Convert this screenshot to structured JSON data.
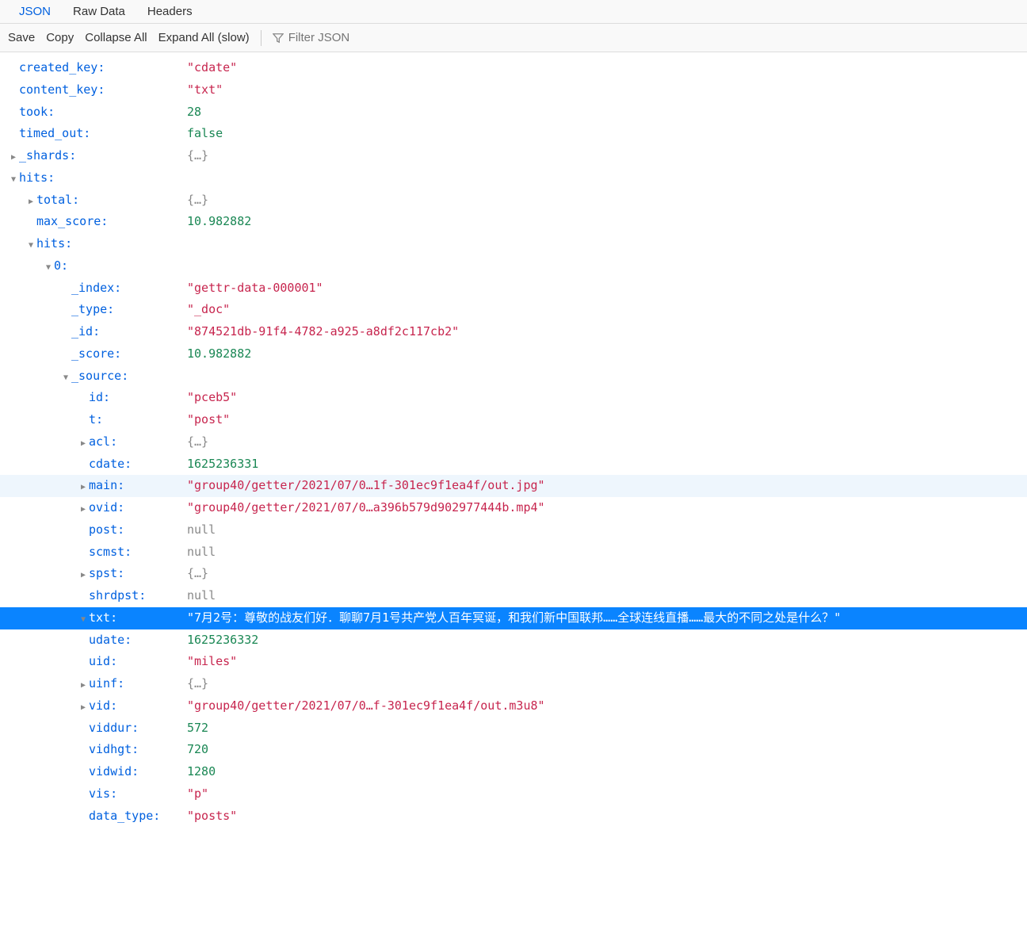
{
  "tabs": {
    "json": "JSON",
    "raw": "Raw Data",
    "headers": "Headers"
  },
  "toolbar": {
    "save": "Save",
    "copy": "Copy",
    "collapseAll": "Collapse All",
    "expandAll": "Expand All (slow)",
    "filterPlaceholder": "Filter JSON"
  },
  "rows": [
    {
      "indent": 1,
      "tg": "",
      "key": "created_key:",
      "vt": "string",
      "v": "\"cdate\""
    },
    {
      "indent": 1,
      "tg": "",
      "key": "content_key:",
      "vt": "string",
      "v": "\"txt\""
    },
    {
      "indent": 1,
      "tg": "",
      "key": "took:",
      "vt": "number",
      "v": "28"
    },
    {
      "indent": 1,
      "tg": "",
      "key": "timed_out:",
      "vt": "bool",
      "v": "false"
    },
    {
      "indent": 1,
      "tg": "r",
      "key": "_shards:",
      "vt": "obj",
      "v": "{…}"
    },
    {
      "indent": 1,
      "tg": "d",
      "key": "hits:",
      "vt": "",
      "v": ""
    },
    {
      "indent": 2,
      "tg": "r",
      "key": "total:",
      "vt": "obj",
      "v": "{…}"
    },
    {
      "indent": 2,
      "tg": "",
      "key": "max_score:",
      "vt": "number",
      "v": "10.982882"
    },
    {
      "indent": 2,
      "tg": "d",
      "key": "hits:",
      "vt": "",
      "v": ""
    },
    {
      "indent": 3,
      "tg": "d",
      "key": "0:",
      "vt": "",
      "v": ""
    },
    {
      "indent": 4,
      "tg": "",
      "key": "_index:",
      "vt": "string",
      "v": "\"gettr-data-000001\""
    },
    {
      "indent": 4,
      "tg": "",
      "key": "_type:",
      "vt": "string",
      "v": "\"_doc\""
    },
    {
      "indent": 4,
      "tg": "",
      "key": "_id:",
      "vt": "string",
      "v": "\"874521db-91f4-4782-a925-a8df2c117cb2\""
    },
    {
      "indent": 4,
      "tg": "",
      "key": "_score:",
      "vt": "number",
      "v": "10.982882"
    },
    {
      "indent": 4,
      "tg": "d",
      "key": "_source:",
      "vt": "",
      "v": ""
    },
    {
      "indent": 5,
      "tg": "",
      "key": "id:",
      "vt": "string",
      "v": "\"pceb5\""
    },
    {
      "indent": 5,
      "tg": "",
      "key": "t:",
      "vt": "string",
      "v": "\"post\""
    },
    {
      "indent": 5,
      "tg": "r",
      "key": "acl:",
      "vt": "obj",
      "v": "{…}"
    },
    {
      "indent": 5,
      "tg": "",
      "key": "cdate:",
      "vt": "number",
      "v": "1625236331"
    },
    {
      "indent": 5,
      "tg": "r",
      "key": "main:",
      "vt": "string",
      "v": "\"group40/getter/2021/07/0…1f-301ec9f1ea4f/out.jpg\"",
      "rowcls": "hover-main"
    },
    {
      "indent": 5,
      "tg": "r",
      "key": "ovid:",
      "vt": "string",
      "v": "\"group40/getter/2021/07/0…a396b579d902977444b.mp4\""
    },
    {
      "indent": 5,
      "tg": "",
      "key": "post:",
      "vt": "null",
      "v": "null"
    },
    {
      "indent": 5,
      "tg": "",
      "key": "scmst:",
      "vt": "null",
      "v": "null"
    },
    {
      "indent": 5,
      "tg": "r",
      "key": "spst:",
      "vt": "obj",
      "v": "{…}"
    },
    {
      "indent": 5,
      "tg": "",
      "key": "shrdpst:",
      "vt": "null",
      "v": "null"
    },
    {
      "indent": 5,
      "tg": "d",
      "key": "txt:",
      "vt": "string",
      "v": "\"7月2号：尊敬的战友们好．聊聊7月1号共产党人百年冥诞，和我们新中国联邦……全球连线直播……最大的不同之处是什么？\"",
      "rowcls": "selected"
    },
    {
      "indent": 5,
      "tg": "",
      "key": "udate:",
      "vt": "number",
      "v": "1625236332"
    },
    {
      "indent": 5,
      "tg": "",
      "key": "uid:",
      "vt": "string",
      "v": "\"miles\""
    },
    {
      "indent": 5,
      "tg": "r",
      "key": "uinf:",
      "vt": "obj",
      "v": "{…}"
    },
    {
      "indent": 5,
      "tg": "r",
      "key": "vid:",
      "vt": "string",
      "v": "\"group40/getter/2021/07/0…f-301ec9f1ea4f/out.m3u8\""
    },
    {
      "indent": 5,
      "tg": "",
      "key": "viddur:",
      "vt": "number",
      "v": "572"
    },
    {
      "indent": 5,
      "tg": "",
      "key": "vidhgt:",
      "vt": "number",
      "v": "720"
    },
    {
      "indent": 5,
      "tg": "",
      "key": "vidwid:",
      "vt": "number",
      "v": "1280"
    },
    {
      "indent": 5,
      "tg": "",
      "key": "vis:",
      "vt": "string",
      "v": "\"p\""
    },
    {
      "indent": 5,
      "tg": "",
      "key": "data_type:",
      "vt": "string",
      "v": "\"posts\""
    }
  ]
}
